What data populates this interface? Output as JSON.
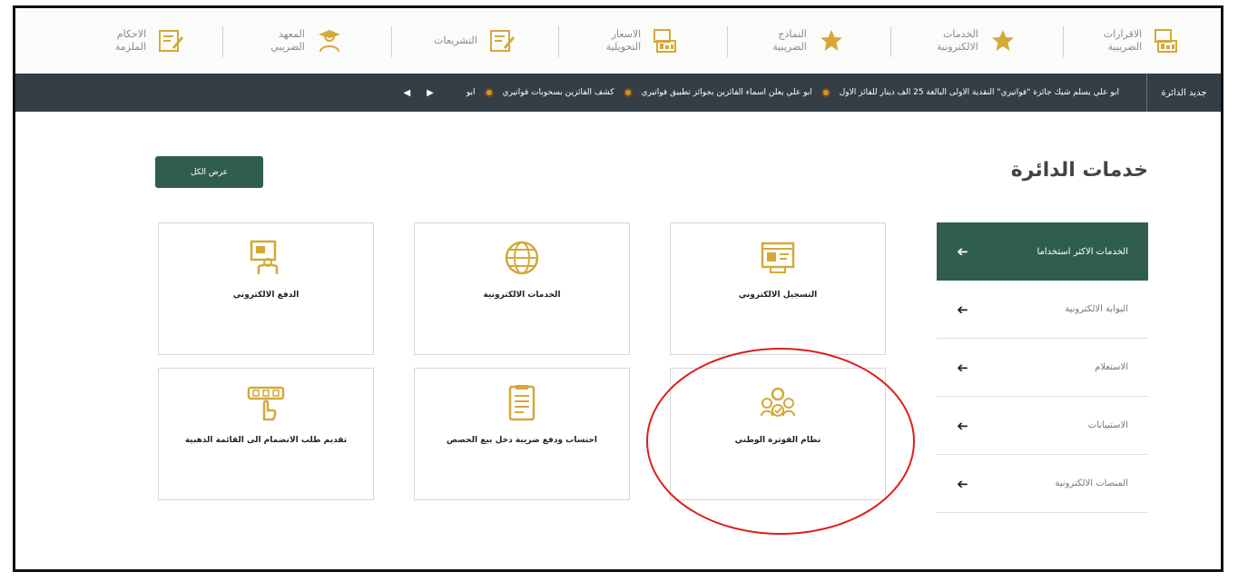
{
  "colors": {
    "accent_green": "#2f5d50",
    "newsbar_bg": "#353d47",
    "icon_gold": "#d4a93a",
    "highlight_red": "#e01c1c"
  },
  "topnav": {
    "items": [
      {
        "label": "الاقرارات\nالضريبية",
        "icon": "tax-declarations-icon"
      },
      {
        "label": "الخدمات\nالالكترونية",
        "icon": "star-icon"
      },
      {
        "label": "النماذج\nالضريبية",
        "icon": "star-icon"
      },
      {
        "label": "الاسعار\nالتحويلية",
        "icon": "transfer-pricing-icon"
      },
      {
        "label": "التشريعات",
        "icon": "legislation-icon"
      },
      {
        "label": "المعهد\nالضريبي",
        "icon": "tax-institute-icon"
      },
      {
        "label": "الاحكام\nالملزمة",
        "icon": "binding-rulings-icon"
      }
    ]
  },
  "news": {
    "title": "جديد الدائرة",
    "items": [
      "ابو علي يسلم شيك جائزة \"فواتيري\" النقدية الأولى البالغة 25 الف دينار للفائز الأول",
      "ابو علي يعلن اسماء الفائزين بجوائز تطبيق فواتيري",
      "كشف الفائزين بسحوبات فواتيري",
      "ابو"
    ],
    "prev_label": "◀",
    "next_label": "▶"
  },
  "main": {
    "title": "خدمات الدائرة",
    "view_all_label": "عرض الكل",
    "side_menu": [
      {
        "label": "الخدمات الاكثر استخداما",
        "active": true
      },
      {
        "label": "البوابة الالكترونية",
        "active": false
      },
      {
        "label": "الاستعلام",
        "active": false
      },
      {
        "label": "الاستبيانات",
        "active": false
      },
      {
        "label": "المنصات الالكترونية",
        "active": false
      }
    ],
    "side_arrow": "➔",
    "cards": [
      {
        "label": "التسجيل الالكتروني",
        "icon": "electronic-registration-icon"
      },
      {
        "label": "الخدمات الالكترونية",
        "icon": "globe-icon"
      },
      {
        "label": "الدفع الالكتروني",
        "icon": "electronic-payment-icon"
      },
      {
        "label": "نظام الفوترة الوطني",
        "icon": "national-invoicing-icon"
      },
      {
        "label": "احتساب ودفع ضريبة دخل بيع الحصص",
        "icon": "calculator-document-icon"
      },
      {
        "label": "تقديم طلب الانضمام الى القائمة الذهبية",
        "icon": "keypad-hand-icon"
      }
    ]
  }
}
